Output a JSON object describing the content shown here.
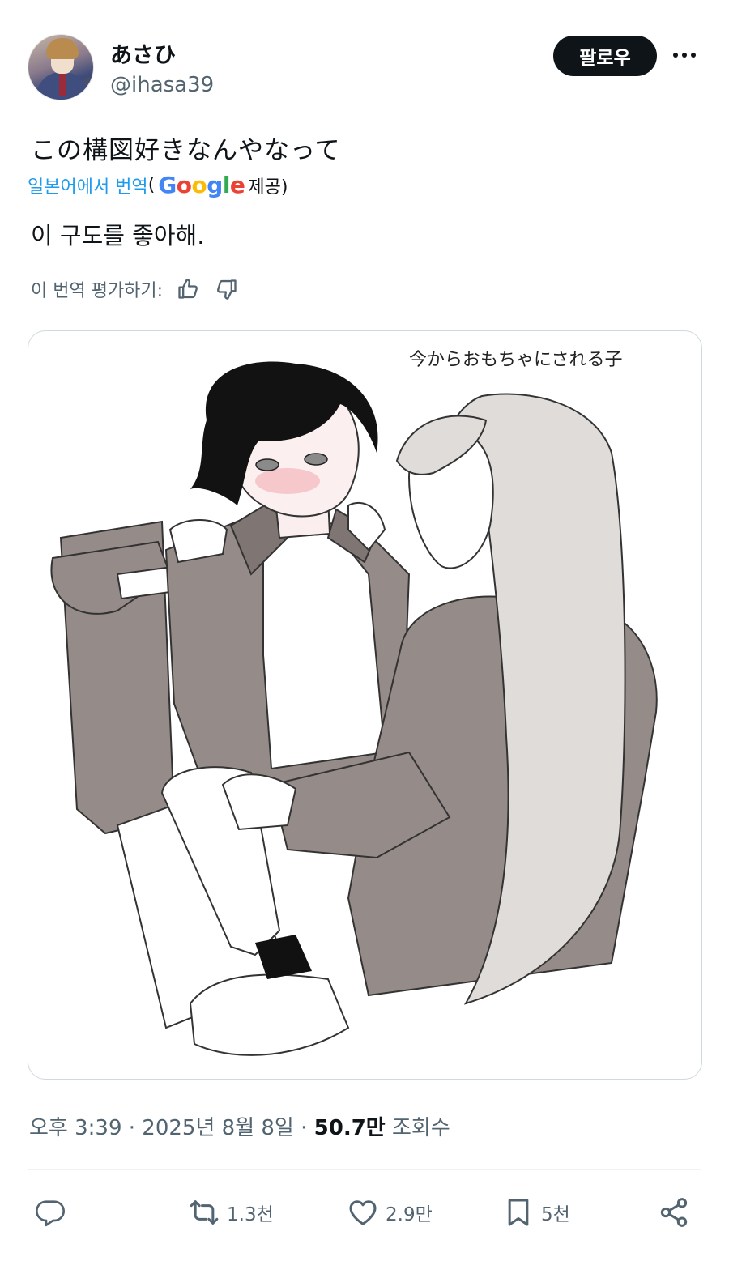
{
  "author": {
    "display_name": "あさひ",
    "handle": "@ihasa39",
    "follow_label": "팔로우"
  },
  "tweet": {
    "text": "この構図好きなんやなって",
    "translation_link": "일본어에서 번역",
    "translation_open_paren": "(",
    "translation_provider": "Google",
    "translation_provided": " 제공)",
    "translated_text": "이 구도를 좋아해.",
    "rate_label": "이 번역 평가하기:"
  },
  "media": {
    "handwritten_caption": "今からおもちゃにされる子"
  },
  "meta": {
    "time": "오후 3:39",
    "separator": " · ",
    "date": "2025년 8월 8일",
    "separator2": " · ",
    "views_count": "50.7만",
    "views_label": " 조회수"
  },
  "actions": {
    "reply_count": "",
    "retweet_count": "1.3천",
    "like_count": "2.9만",
    "bookmark_count": "5천"
  },
  "icons": {
    "reply": "reply-icon",
    "retweet": "retweet-icon",
    "like": "heart-icon",
    "bookmark": "bookmark-icon",
    "share": "share-icon",
    "thumbs_up": "thumbs-up-icon",
    "thumbs_down": "thumbs-down-icon",
    "more": "more-icon"
  },
  "colors": {
    "text": "#0f1419",
    "secondary": "#536471",
    "link": "#1d9bf0",
    "follow_bg": "#0f1419"
  }
}
